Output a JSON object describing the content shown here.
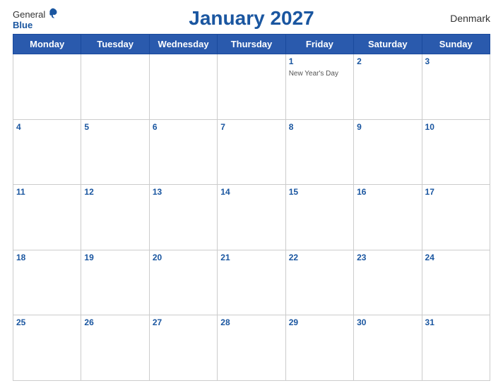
{
  "header": {
    "logo": {
      "general": "General",
      "blue": "Blue",
      "bird_label": "bird-logo"
    },
    "title": "January 2027",
    "country": "Denmark"
  },
  "calendar": {
    "weekdays": [
      "Monday",
      "Tuesday",
      "Wednesday",
      "Thursday",
      "Friday",
      "Saturday",
      "Sunday"
    ],
    "rows": [
      [
        {
          "num": "",
          "event": ""
        },
        {
          "num": "",
          "event": ""
        },
        {
          "num": "",
          "event": ""
        },
        {
          "num": "",
          "event": ""
        },
        {
          "num": "1",
          "event": "New Year's Day"
        },
        {
          "num": "2",
          "event": ""
        },
        {
          "num": "3",
          "event": ""
        }
      ],
      [
        {
          "num": "4",
          "event": ""
        },
        {
          "num": "5",
          "event": ""
        },
        {
          "num": "6",
          "event": ""
        },
        {
          "num": "7",
          "event": ""
        },
        {
          "num": "8",
          "event": ""
        },
        {
          "num": "9",
          "event": ""
        },
        {
          "num": "10",
          "event": ""
        }
      ],
      [
        {
          "num": "11",
          "event": ""
        },
        {
          "num": "12",
          "event": ""
        },
        {
          "num": "13",
          "event": ""
        },
        {
          "num": "14",
          "event": ""
        },
        {
          "num": "15",
          "event": ""
        },
        {
          "num": "16",
          "event": ""
        },
        {
          "num": "17",
          "event": ""
        }
      ],
      [
        {
          "num": "18",
          "event": ""
        },
        {
          "num": "19",
          "event": ""
        },
        {
          "num": "20",
          "event": ""
        },
        {
          "num": "21",
          "event": ""
        },
        {
          "num": "22",
          "event": ""
        },
        {
          "num": "23",
          "event": ""
        },
        {
          "num": "24",
          "event": ""
        }
      ],
      [
        {
          "num": "25",
          "event": ""
        },
        {
          "num": "26",
          "event": ""
        },
        {
          "num": "27",
          "event": ""
        },
        {
          "num": "28",
          "event": ""
        },
        {
          "num": "29",
          "event": ""
        },
        {
          "num": "30",
          "event": ""
        },
        {
          "num": "31",
          "event": ""
        }
      ]
    ]
  }
}
